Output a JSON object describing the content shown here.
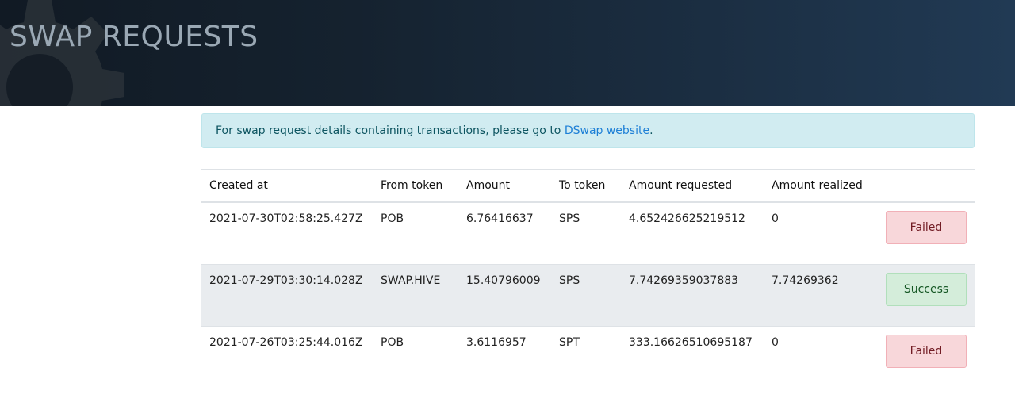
{
  "header": {
    "title": "SWAP REQUESTS"
  },
  "notice": {
    "text": "For swap request details containing transactions, please go to ",
    "link_text": "DSwap website",
    "suffix": "."
  },
  "table": {
    "columns": [
      "Created at",
      "From token",
      "Amount",
      "To token",
      "Amount requested",
      "Amount realized",
      ""
    ],
    "rows": [
      {
        "created_at": "2021-07-30T02:58:25.427Z",
        "from_token": "POB",
        "amount": "6.76416637",
        "to_token": "SPS",
        "amount_requested": "4.652426625219512",
        "amount_realized": "0",
        "status": "Failed"
      },
      {
        "created_at": "2021-07-29T03:30:14.028Z",
        "from_token": "SWAP.HIVE",
        "amount": "15.40796009",
        "to_token": "SPS",
        "amount_requested": "7.74269359037883",
        "amount_realized": "7.74269362",
        "status": "Success"
      },
      {
        "created_at": "2021-07-26T03:25:44.016Z",
        "from_token": "POB",
        "amount": "3.6116957",
        "to_token": "SPT",
        "amount_requested": "333.16626510695187",
        "amount_realized": "0",
        "status": "Failed"
      }
    ]
  },
  "colors": {
    "failed_bg": "#f8d7da",
    "success_bg": "#d4edda",
    "alert_bg": "#d1ecf1",
    "link": "#1d7fd6"
  },
  "icons": {
    "hero_background": "gear-icon"
  }
}
